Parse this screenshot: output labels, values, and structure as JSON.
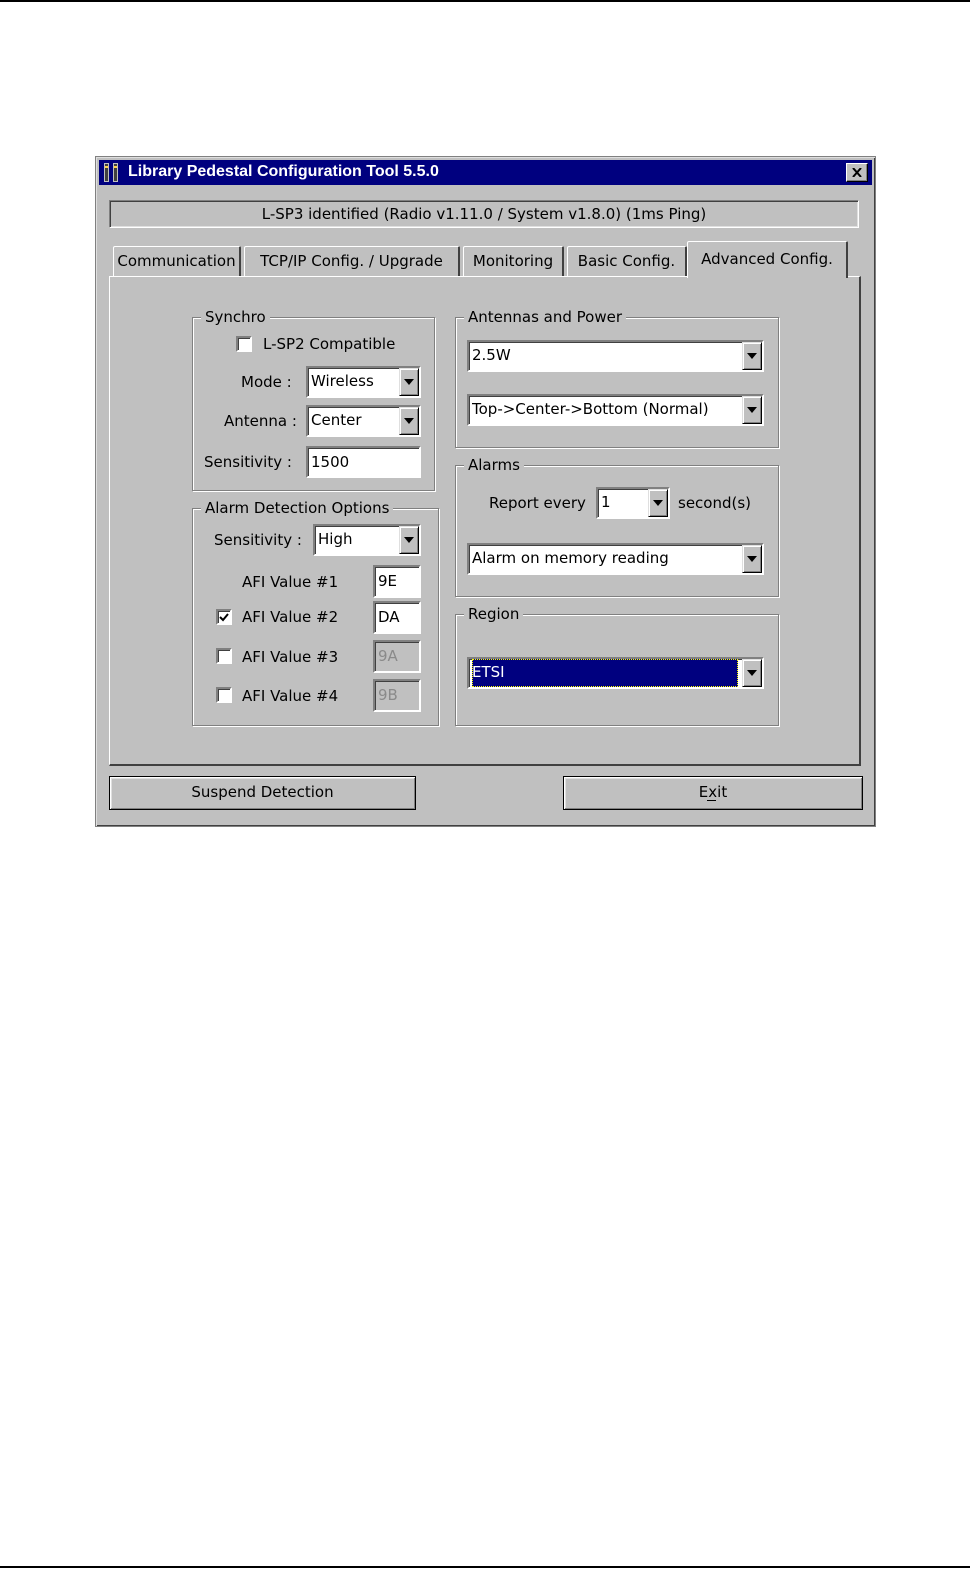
{
  "window": {
    "title": "Library Pedestal Configuration Tool 5.5.0",
    "close_label": "×"
  },
  "status": {
    "text": "L-SP3 identified (Radio v1.11.0 / System v1.8.0) (1ms Ping)"
  },
  "tabs": [
    {
      "label": "Communication",
      "active": false
    },
    {
      "label": "TCP/IP Config. / Upgrade",
      "active": false
    },
    {
      "label": "Monitoring",
      "active": false
    },
    {
      "label": "Basic Config.",
      "active": false
    },
    {
      "label": "Advanced Config.",
      "active": true
    }
  ],
  "synchro": {
    "legend": "Synchro",
    "lsp2_compatible_label": "L-SP2 Compatible",
    "lsp2_compatible_checked": false,
    "mode_label": "Mode :",
    "mode_value": "Wireless",
    "antenna_label": "Antenna :",
    "antenna_value": "Center",
    "sensitivity_label": "Sensitivity :",
    "sensitivity_value": "1500"
  },
  "alarm_detection": {
    "legend": "Alarm Detection Options",
    "sensitivity_label": "Sensitivity :",
    "sensitivity_value": "High",
    "afi": [
      {
        "label": "AFI Value #1",
        "value": "9E",
        "has_checkbox": false,
        "checked": null,
        "enabled": true
      },
      {
        "label": "AFI Value #2",
        "value": "DA",
        "has_checkbox": true,
        "checked": true,
        "enabled": true
      },
      {
        "label": "AFI Value #3",
        "value": "9A",
        "has_checkbox": true,
        "checked": false,
        "enabled": false
      },
      {
        "label": "AFI Value #4",
        "value": "9B",
        "has_checkbox": true,
        "checked": false,
        "enabled": false
      }
    ]
  },
  "antennas_power": {
    "legend": "Antennas and Power",
    "power_value": "2.5W",
    "sequence_value": "Top->Center->Bottom (Normal)"
  },
  "alarms": {
    "legend": "Alarms",
    "report_every_label": "Report every",
    "report_every_value": "1",
    "seconds_label": "second(s)",
    "alarm_mode_value": "Alarm on  memory reading"
  },
  "region": {
    "legend": "Region",
    "value": "ETSI"
  },
  "buttons": {
    "suspend_label": "Suspend Detection",
    "exit_label": "Exit",
    "exit_mnemonic": "x"
  }
}
